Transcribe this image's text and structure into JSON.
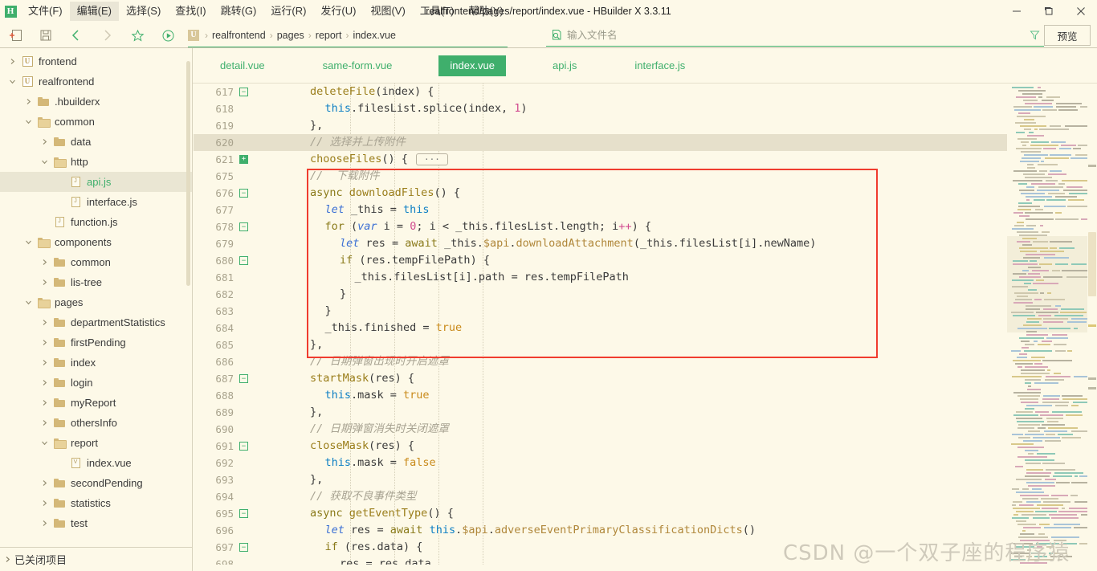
{
  "window": {
    "title": "realfrontend/pages/report/index.vue - HBuilder X 3.3.11",
    "logo": "H",
    "minimize": "minimize-icon",
    "maximize": "maximize-icon",
    "close": "close-icon"
  },
  "menu": {
    "items": [
      {
        "label": "文件(F)",
        "active": false
      },
      {
        "label": "编辑(E)",
        "active": true
      },
      {
        "label": "选择(S)",
        "active": false
      },
      {
        "label": "查找(I)",
        "active": false
      },
      {
        "label": "跳转(G)",
        "active": false
      },
      {
        "label": "运行(R)",
        "active": false
      },
      {
        "label": "发行(U)",
        "active": false
      },
      {
        "label": "视图(V)",
        "active": false
      },
      {
        "label": "工具(T)",
        "active": false
      },
      {
        "label": "帮助(Y)",
        "active": false
      }
    ]
  },
  "toolbar": {
    "icons": [
      "new-file-icon",
      "save-icon",
      "back-icon",
      "forward-icon",
      "star-icon",
      "run-icon"
    ],
    "breadcrumb": {
      "project_icon": "U",
      "items": [
        "realfrontend",
        "pages",
        "report",
        "index.vue"
      ]
    },
    "search": {
      "icon": "file-search-icon",
      "placeholder": "输入文件名",
      "value": "",
      "filter_icon": "filter-icon"
    },
    "preview_label": "预览"
  },
  "sidebar": {
    "items": [
      {
        "label": "frontend",
        "depth": 0,
        "type": "project",
        "state": "collapsed",
        "selected": false
      },
      {
        "label": "realfrontend",
        "depth": 0,
        "type": "project",
        "state": "expanded",
        "selected": false
      },
      {
        "label": ".hbuilderx",
        "depth": 1,
        "type": "folder",
        "state": "collapsed",
        "selected": false
      },
      {
        "label": "common",
        "depth": 1,
        "type": "folder",
        "state": "expanded",
        "selected": false
      },
      {
        "label": "data",
        "depth": 2,
        "type": "folder",
        "state": "collapsed",
        "selected": false
      },
      {
        "label": "http",
        "depth": 2,
        "type": "folder",
        "state": "expanded",
        "selected": false
      },
      {
        "label": "api.js",
        "depth": 3,
        "type": "file-js",
        "state": "none",
        "selected": true,
        "active": true
      },
      {
        "label": "interface.js",
        "depth": 3,
        "type": "file-js",
        "state": "none",
        "selected": false
      },
      {
        "label": "function.js",
        "depth": 2,
        "type": "file-js",
        "state": "none",
        "selected": false
      },
      {
        "label": "components",
        "depth": 1,
        "type": "folder",
        "state": "expanded",
        "selected": false
      },
      {
        "label": "common",
        "depth": 2,
        "type": "folder",
        "state": "collapsed",
        "selected": false
      },
      {
        "label": "lis-tree",
        "depth": 2,
        "type": "folder",
        "state": "collapsed",
        "selected": false
      },
      {
        "label": "pages",
        "depth": 1,
        "type": "folder",
        "state": "expanded",
        "selected": false
      },
      {
        "label": "departmentStatistics",
        "depth": 2,
        "type": "folder",
        "state": "collapsed",
        "selected": false
      },
      {
        "label": "firstPending",
        "depth": 2,
        "type": "folder",
        "state": "collapsed",
        "selected": false
      },
      {
        "label": "index",
        "depth": 2,
        "type": "folder",
        "state": "collapsed",
        "selected": false
      },
      {
        "label": "login",
        "depth": 2,
        "type": "folder",
        "state": "collapsed",
        "selected": false
      },
      {
        "label": "myReport",
        "depth": 2,
        "type": "folder",
        "state": "collapsed",
        "selected": false
      },
      {
        "label": "othersInfo",
        "depth": 2,
        "type": "folder",
        "state": "collapsed",
        "selected": false
      },
      {
        "label": "report",
        "depth": 2,
        "type": "folder",
        "state": "expanded",
        "selected": false
      },
      {
        "label": "index.vue",
        "depth": 3,
        "type": "file-vue",
        "state": "none",
        "selected": false
      },
      {
        "label": "secondPending",
        "depth": 2,
        "type": "folder",
        "state": "collapsed",
        "selected": false
      },
      {
        "label": "statistics",
        "depth": 2,
        "type": "folder",
        "state": "collapsed",
        "selected": false
      },
      {
        "label": "test",
        "depth": 2,
        "type": "folder",
        "state": "collapsed",
        "selected": false
      }
    ],
    "footer_label": "已关闭项目"
  },
  "tabs": [
    {
      "label": "detail.vue",
      "active": false
    },
    {
      "label": "same-form.vue",
      "active": false
    },
    {
      "label": "index.vue",
      "active": true
    },
    {
      "label": "api.js",
      "active": false
    },
    {
      "label": "interface.js",
      "active": false
    }
  ],
  "editor": {
    "accent_color": "#3faf6c",
    "highlight_box_color": "#f03c2e",
    "lines": [
      {
        "num": "617",
        "fold": "minus",
        "indent": 2,
        "highlight": false,
        "tokens": [
          {
            "t": "deleteFile",
            "c": "k-fn"
          },
          {
            "t": "(index) {",
            "c": "k-plain"
          }
        ]
      },
      {
        "num": "618",
        "fold": "",
        "indent": 3,
        "highlight": false,
        "tokens": [
          {
            "t": "this",
            "c": "k-kw"
          },
          {
            "t": ".filesList.splice(index, ",
            "c": "k-plain"
          },
          {
            "t": "1",
            "c": "k-num"
          },
          {
            "t": ")",
            "c": "k-plain"
          }
        ]
      },
      {
        "num": "619",
        "fold": "",
        "indent": 2,
        "highlight": false,
        "tokens": [
          {
            "t": "},",
            "c": "k-plain"
          }
        ]
      },
      {
        "num": "620",
        "fold": "",
        "indent": 2,
        "highlight": true,
        "tokens": [
          {
            "t": "// 选择并上传附件",
            "c": "k-cmt"
          }
        ]
      },
      {
        "num": "621",
        "fold": "plus",
        "indent": 2,
        "highlight": false,
        "tokens": [
          {
            "t": "chooseFiles",
            "c": "k-fn"
          },
          {
            "t": "() { ",
            "c": "k-plain"
          },
          {
            "t": "···",
            "c": "ellipsis"
          }
        ]
      },
      {
        "num": "675",
        "fold": "",
        "indent": 2,
        "highlight": false,
        "tokens": [
          {
            "t": "//  下载附件",
            "c": "k-cmt"
          }
        ]
      },
      {
        "num": "676",
        "fold": "minus",
        "indent": 2,
        "highlight": false,
        "tokens": [
          {
            "t": "async ",
            "c": "k-ctl"
          },
          {
            "t": "downloadFiles",
            "c": "k-fn"
          },
          {
            "t": "() {",
            "c": "k-plain"
          }
        ]
      },
      {
        "num": "677",
        "fold": "",
        "indent": 3,
        "highlight": false,
        "tokens": [
          {
            "t": "let",
            "c": "k-let"
          },
          {
            "t": " _this = ",
            "c": "k-plain"
          },
          {
            "t": "this",
            "c": "k-kw"
          }
        ]
      },
      {
        "num": "678",
        "fold": "minus",
        "indent": 3,
        "highlight": false,
        "tokens": [
          {
            "t": "for",
            "c": "k-ctl"
          },
          {
            "t": " (",
            "c": "k-plain"
          },
          {
            "t": "var",
            "c": "k-var"
          },
          {
            "t": " i = ",
            "c": "k-plain"
          },
          {
            "t": "0",
            "c": "k-num"
          },
          {
            "t": "; i < _this.filesList.length; i",
            "c": "k-plain"
          },
          {
            "t": "++",
            "c": "k-num"
          },
          {
            "t": ") {",
            "c": "k-plain"
          }
        ]
      },
      {
        "num": "679",
        "fold": "",
        "indent": 4,
        "highlight": false,
        "tokens": [
          {
            "t": "let",
            "c": "k-let"
          },
          {
            "t": " res = ",
            "c": "k-plain"
          },
          {
            "t": "await",
            "c": "k-ctl"
          },
          {
            "t": " _this.",
            "c": "k-plain"
          },
          {
            "t": "$api",
            "c": "k-api"
          },
          {
            "t": ".",
            "c": "k-plain"
          },
          {
            "t": "downloadAttachment",
            "c": "k-api"
          },
          {
            "t": "(_this.filesList[i].newName)",
            "c": "k-plain"
          }
        ]
      },
      {
        "num": "680",
        "fold": "minus",
        "indent": 4,
        "highlight": false,
        "tokens": [
          {
            "t": "if",
            "c": "k-ctl"
          },
          {
            "t": " (res.tempFilePath) {",
            "c": "k-plain"
          }
        ]
      },
      {
        "num": "681",
        "fold": "",
        "indent": 5,
        "highlight": false,
        "tokens": [
          {
            "t": "_this.filesList[i].path = res.tempFilePath",
            "c": "k-plain"
          }
        ]
      },
      {
        "num": "682",
        "fold": "",
        "indent": 4,
        "highlight": false,
        "tokens": [
          {
            "t": "}",
            "c": "k-plain"
          }
        ]
      },
      {
        "num": "683",
        "fold": "",
        "indent": 3,
        "highlight": false,
        "tokens": [
          {
            "t": "}",
            "c": "k-plain"
          }
        ]
      },
      {
        "num": "684",
        "fold": "",
        "indent": 3,
        "highlight": false,
        "tokens": [
          {
            "t": "_this.finished = ",
            "c": "k-plain"
          },
          {
            "t": "true",
            "c": "k-bool"
          }
        ]
      },
      {
        "num": "685",
        "fold": "",
        "indent": 2,
        "highlight": false,
        "tokens": [
          {
            "t": "},",
            "c": "k-plain"
          }
        ]
      },
      {
        "num": "686",
        "fold": "",
        "indent": 2,
        "highlight": false,
        "tokens": [
          {
            "t": "// 日期弹窗出现时开启遮罩",
            "c": "k-cmt"
          }
        ]
      },
      {
        "num": "687",
        "fold": "minus",
        "indent": 2,
        "highlight": false,
        "tokens": [
          {
            "t": "startMask",
            "c": "k-fn"
          },
          {
            "t": "(res) {",
            "c": "k-plain"
          }
        ]
      },
      {
        "num": "688",
        "fold": "",
        "indent": 3,
        "highlight": false,
        "tokens": [
          {
            "t": "this",
            "c": "k-kw"
          },
          {
            "t": ".mask = ",
            "c": "k-plain"
          },
          {
            "t": "true",
            "c": "k-bool"
          }
        ]
      },
      {
        "num": "689",
        "fold": "",
        "indent": 2,
        "highlight": false,
        "tokens": [
          {
            "t": "},",
            "c": "k-plain"
          }
        ]
      },
      {
        "num": "690",
        "fold": "",
        "indent": 2,
        "highlight": false,
        "tokens": [
          {
            "t": "// 日期弹窗消失时关闭遮罩",
            "c": "k-cmt"
          }
        ]
      },
      {
        "num": "691",
        "fold": "minus",
        "indent": 2,
        "highlight": false,
        "tokens": [
          {
            "t": "closeMask",
            "c": "k-fn"
          },
          {
            "t": "(res) {",
            "c": "k-plain"
          }
        ]
      },
      {
        "num": "692",
        "fold": "",
        "indent": 3,
        "highlight": false,
        "tokens": [
          {
            "t": "this",
            "c": "k-kw"
          },
          {
            "t": ".mask = ",
            "c": "k-plain"
          },
          {
            "t": "false",
            "c": "k-bool"
          }
        ]
      },
      {
        "num": "693",
        "fold": "",
        "indent": 2,
        "highlight": false,
        "tokens": [
          {
            "t": "},",
            "c": "k-plain"
          }
        ]
      },
      {
        "num": "694",
        "fold": "",
        "indent": 2,
        "highlight": false,
        "tokens": [
          {
            "t": "// 获取不良事件类型",
            "c": "k-cmt"
          }
        ]
      },
      {
        "num": "695",
        "fold": "minus",
        "indent": 2,
        "highlight": false,
        "tokens": [
          {
            "t": "async ",
            "c": "k-ctl"
          },
          {
            "t": "getEventType",
            "c": "k-fn"
          },
          {
            "t": "() {",
            "c": "k-plain"
          }
        ]
      },
      {
        "num": "696",
        "fold": "",
        "indent": 3,
        "highlight": false,
        "tokens": [
          {
            "t": "let",
            "c": "k-let"
          },
          {
            "t": " res = ",
            "c": "k-plain"
          },
          {
            "t": "await",
            "c": "k-ctl"
          },
          {
            "t": " ",
            "c": "k-plain"
          },
          {
            "t": "this",
            "c": "k-kw"
          },
          {
            "t": ".",
            "c": "k-plain"
          },
          {
            "t": "$api",
            "c": "k-api"
          },
          {
            "t": ".",
            "c": "k-plain"
          },
          {
            "t": "adverseEventPrimaryClassificationDicts",
            "c": "k-api"
          },
          {
            "t": "()",
            "c": "k-plain"
          }
        ]
      },
      {
        "num": "697",
        "fold": "minus",
        "indent": 3,
        "highlight": false,
        "tokens": [
          {
            "t": "if",
            "c": "k-ctl"
          },
          {
            "t": " (res.data) {",
            "c": "k-plain"
          }
        ]
      },
      {
        "num": "698",
        "fold": "",
        "indent": 4,
        "highlight": false,
        "tokens": [
          {
            "t": "res = res.data",
            "c": "k-plain"
          }
        ]
      }
    ]
  },
  "watermark": {
    "text": "CSDN @一个双子座的程序猿"
  }
}
